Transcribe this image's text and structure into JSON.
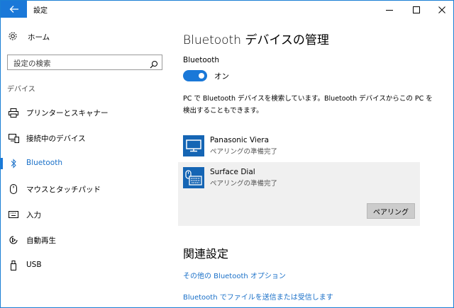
{
  "window": {
    "title": "設定",
    "back_icon": "arrow-left-icon",
    "minimize_icon": "minimize-icon",
    "maximize_icon": "maximize-icon",
    "close_icon": "close-icon",
    "accent": "#1a78d8"
  },
  "sidebar": {
    "home_label": "ホーム",
    "search_placeholder": "設定の検索",
    "section_header": "デバイス",
    "items": [
      {
        "label": "プリンターとスキャナー",
        "icon": "printer-icon"
      },
      {
        "label": "接続中のデバイス",
        "icon": "connected-devices-icon"
      },
      {
        "label": "Bluetooth",
        "icon": "bluetooth-icon",
        "selected": true
      },
      {
        "label": "マウスとタッチパッド",
        "icon": "mouse-icon"
      },
      {
        "label": "入力",
        "icon": "keyboard-icon"
      },
      {
        "label": "自動再生",
        "icon": "autoplay-icon"
      },
      {
        "label": "USB",
        "icon": "usb-icon"
      }
    ]
  },
  "main": {
    "title": "Bluetooth デバイスの管理",
    "bluetooth_label": "Bluetooth",
    "toggle_state": "オン",
    "toggle_on": true,
    "description": "PC で Bluetooth デバイスを検索しています。Bluetooth デバイスからこの PC を検出することもできます。",
    "devices": [
      {
        "name": "Panasonic Viera",
        "status": "ペアリングの準備完了",
        "icon": "monitor-icon"
      },
      {
        "name": "Surface Dial",
        "status": "ペアリングの準備完了",
        "icon": "input-device-icon"
      }
    ],
    "pair_button": "ペアリング",
    "related_title": "関連設定",
    "links": [
      "その他の Bluetooth オプション",
      "Bluetooth でファイルを送信または受信します"
    ]
  }
}
